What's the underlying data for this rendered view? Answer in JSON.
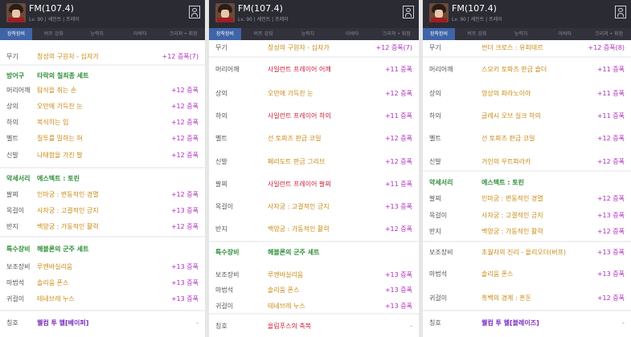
{
  "character": {
    "name": "FM(107.4)",
    "subtitle": "Lv. 90 | 세인트 | 프레이"
  },
  "tabs": [
    "장착장비",
    "버프 강화",
    "능력치",
    "아바타",
    "크리쳐 • 휘장"
  ],
  "panels": [
    {
      "rows": [
        {
          "label": "무기",
          "name": "창성의 구원자 - 십자가",
          "ench": "+12 증폭(7)",
          "color": "gold"
        },
        {
          "label": "방어구",
          "name": "타락의 칠죄종 세트",
          "ench": "",
          "cat": true,
          "color": "green"
        },
        {
          "label": "머리어깨",
          "name": "탐식을 쥐는 손",
          "ench": "+12 증폭",
          "color": "gold"
        },
        {
          "label": "상의",
          "name": "오만에 가득찬 눈",
          "ench": "+12 증폭",
          "color": "gold"
        },
        {
          "label": "하의",
          "name": "복식하는 입",
          "ench": "+12 증폭",
          "color": "gold"
        },
        {
          "label": "벨트",
          "name": "질투를 밀하는 혀",
          "ench": "+12 증폭",
          "color": "gold"
        },
        {
          "label": "신발",
          "name": "나태함을 가진 발",
          "ench": "+12 증폭",
          "color": "gold"
        },
        {
          "label": "악세서리",
          "name": "에스텍트 : 토린",
          "ench": "",
          "cat": true,
          "color": "green"
        },
        {
          "label": "팔찌",
          "name": "인마궁 : 변동적인 경멸",
          "ench": "+12 증폭",
          "color": "gold"
        },
        {
          "label": "목걸이",
          "name": "사자궁 : 고결적인 긍지",
          "ench": "+13 증폭",
          "color": "gold"
        },
        {
          "label": "반지",
          "name": "백양궁 : 가동적인 활력",
          "ench": "+12 증폭",
          "color": "gold"
        },
        {
          "label": "특수장비",
          "name": "헤블론의 군주 세트",
          "ench": "",
          "cat": true,
          "color": "green"
        },
        {
          "label": "보조장비",
          "name": "루엔바실리움",
          "ench": "+13 증폭",
          "color": "gold"
        },
        {
          "label": "마법석",
          "name": "솔리움 폰스",
          "ench": "+13 증폭",
          "color": "gold"
        },
        {
          "label": "귀걸이",
          "name": "테네브레 누스",
          "ench": "+13 증폭",
          "color": "gold"
        },
        {
          "label": "칭호",
          "name": "웰컴 투 헬[베이퍼]",
          "ench": "-",
          "color": "purple"
        }
      ]
    },
    {
      "rows": [
        {
          "label": "무기",
          "name": "창성의 구원자 - 십자가",
          "ench": "+12 증폭(7)",
          "color": "gold"
        },
        {
          "label": "머리어깨",
          "name": "사일런트 프레이어 어깨",
          "ench": "+11 증폭",
          "color": "red"
        },
        {
          "label": "상의",
          "name": "오만에 가득찬 눈",
          "ench": "+12 증폭",
          "color": "gold"
        },
        {
          "label": "하의",
          "name": "사일런트 프레이어 하의",
          "ench": "+11 증폭",
          "color": "red"
        },
        {
          "label": "벨트",
          "name": "선 토파즈 판금 코일",
          "ench": "+12 증폭",
          "color": "gold"
        },
        {
          "label": "신발",
          "name": "페리도트 판금 그리브",
          "ench": "+12 증폭",
          "color": "gold"
        },
        {
          "label": "팔찌",
          "name": "사일런트 프레이어 팔찌",
          "ench": "+11 증폭",
          "color": "red"
        },
        {
          "label": "목걸이",
          "name": "사자궁 : 고결적인 긍지",
          "ench": "+13 증폭",
          "color": "gold"
        },
        {
          "label": "반지",
          "name": "백양궁 : 가동적인 활력",
          "ench": "+12 증폭",
          "color": "gold"
        },
        {
          "label": "특수장비",
          "name": "헤블론의 군주 세트",
          "ench": "",
          "cat": true,
          "color": "green"
        },
        {
          "label": "보조장비",
          "name": "루엔바실리움",
          "ench": "+13 증폭",
          "color": "gold"
        },
        {
          "label": "마법석",
          "name": "솔리움 폰스",
          "ench": "+13 증폭",
          "color": "gold"
        },
        {
          "label": "귀걸이",
          "name": "테네브레 누스",
          "ench": "+13 증폭",
          "color": "gold"
        },
        {
          "label": "칭호",
          "name": "올림푸스의 축복",
          "ench": "-",
          "color": "red"
        }
      ]
    },
    {
      "rows": [
        {
          "label": "무기",
          "name": "썬더 크로스 : 유피테르",
          "ench": "+12 증폭(8)",
          "color": "gold"
        },
        {
          "label": "머리어깨",
          "name": "스모키 토파즈 판금 숄더",
          "ench": "+11 증폭",
          "color": "gold"
        },
        {
          "label": "상의",
          "name": "영상의 파라노이아",
          "ench": "+11 증폭",
          "color": "gold"
        },
        {
          "label": "하의",
          "name": "글레시 오브 실크 하의",
          "ench": "+11 증폭",
          "color": "gold"
        },
        {
          "label": "벨트",
          "name": "선 토파즈 판금 코일",
          "ench": "+12 증폭",
          "color": "gold"
        },
        {
          "label": "신발",
          "name": "거인의 우트파라카",
          "ench": "+12 증폭",
          "color": "gold"
        },
        {
          "label": "악세서리",
          "name": "에스텍트 : 토린",
          "ench": "",
          "cat": true,
          "color": "green"
        },
        {
          "label": "팔찌",
          "name": "인마궁 : 변동적인 경멸",
          "ench": "+12 증폭",
          "color": "gold"
        },
        {
          "label": "목걸이",
          "name": "사자궁 : 고결적인 긍지",
          "ench": "+13 증폭",
          "color": "gold"
        },
        {
          "label": "반지",
          "name": "백양궁 : 가동적인 활력",
          "ench": "+12 증폭",
          "color": "gold"
        },
        {
          "label": "보조장비",
          "name": "초월자의 진리 - 올리오더(버프)",
          "ench": "+13 증폭",
          "color": "gold"
        },
        {
          "label": "마법석",
          "name": "솔리움 폰스",
          "ench": "+13 증폭",
          "color": "gold"
        },
        {
          "label": "귀걸이",
          "name": "흑백의 경계 : 흔돈",
          "ench": "+12 증폭",
          "color": "gold"
        },
        {
          "label": "칭호",
          "name": "웰컴 투 헬[블레이즈]",
          "ench": "-",
          "color": "purple"
        }
      ]
    }
  ]
}
